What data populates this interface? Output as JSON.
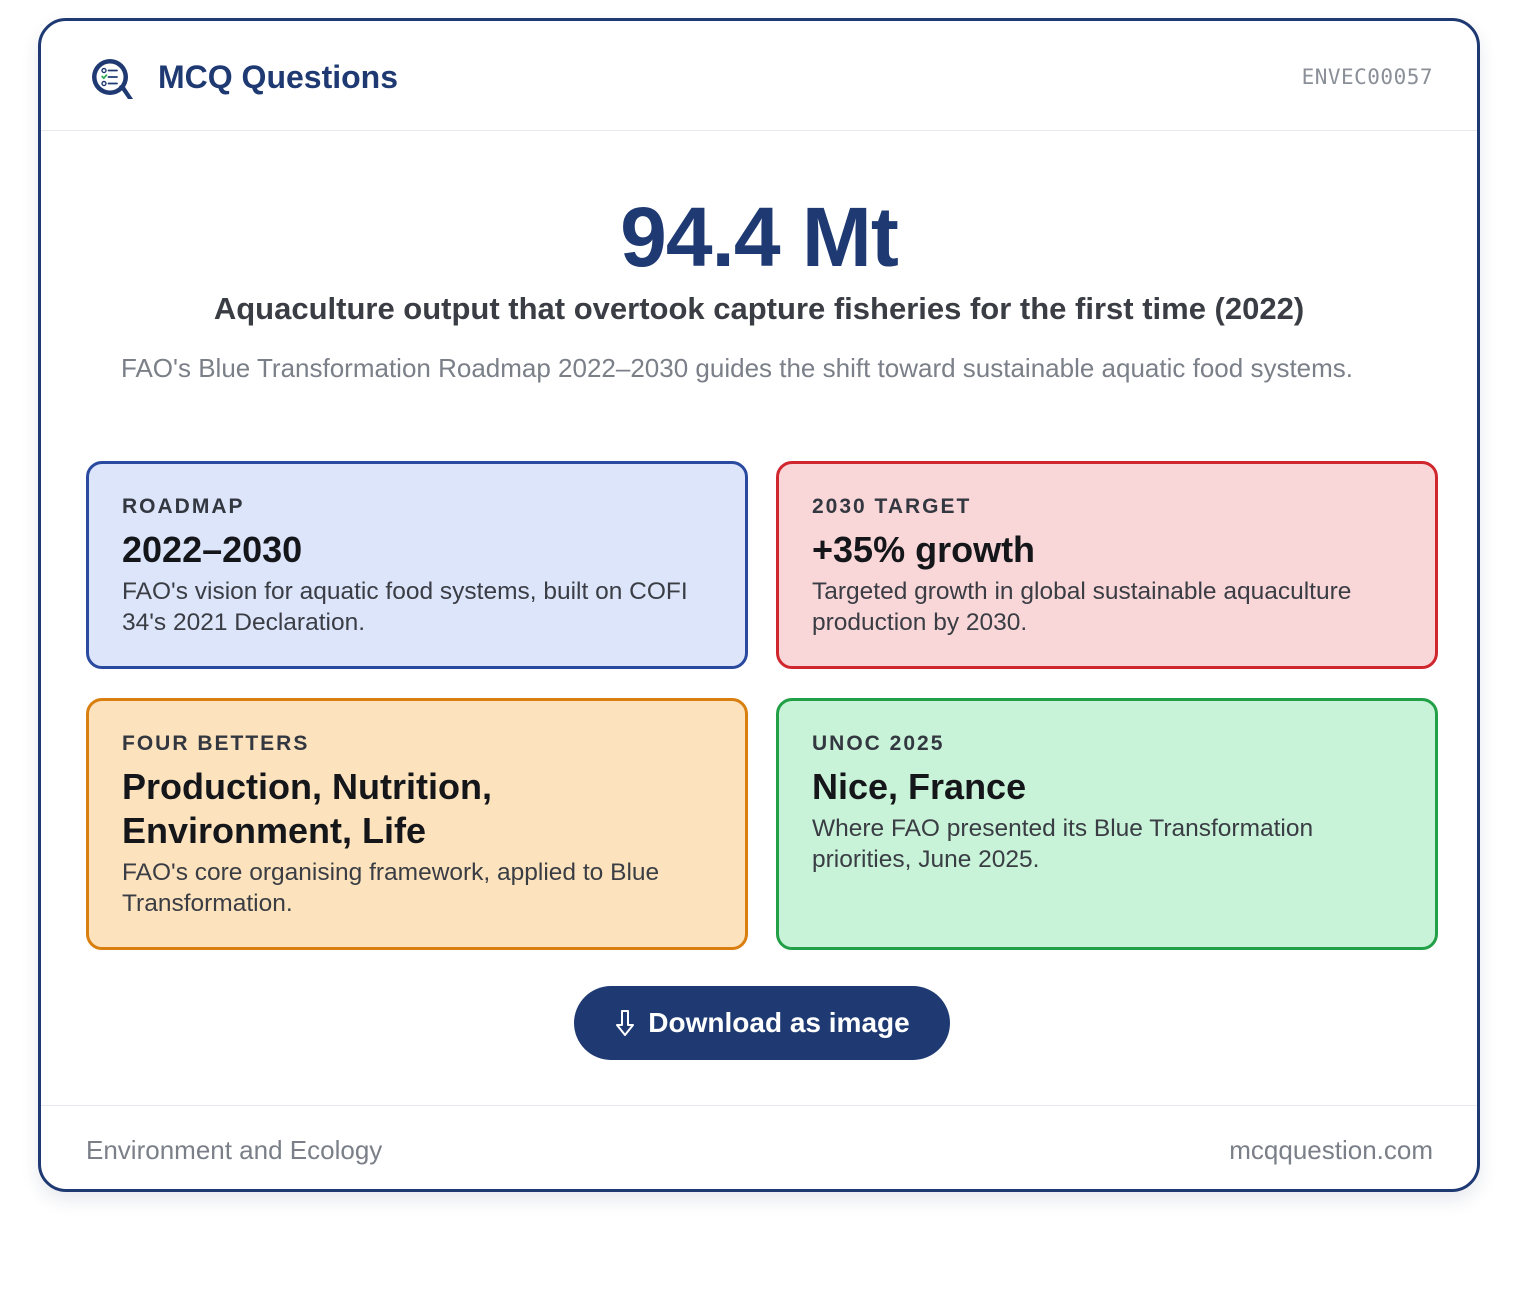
{
  "header": {
    "brand": "MCQ Questions",
    "code": "ENVEC00057"
  },
  "stat": {
    "value": "94.4 Mt",
    "caption": "Aquaculture output that overtook capture fisheries for the first time (2022)",
    "description": "FAO's Blue Transformation Roadmap 2022–2030 guides the shift toward sustainable aquatic food systems."
  },
  "boxes": [
    {
      "label": "ROADMAP",
      "value": "2022–2030",
      "text": "FAO's vision for aquatic food systems, built on COFI 34's 2021 Declaration.",
      "background": "#dde5fb",
      "border": "#2a4aa0"
    },
    {
      "label": "2030 TARGET",
      "value": "+35% growth",
      "text": "Targeted growth in global sustainable aquaculture production by 2030.",
      "background": "#f9d7d9",
      "border": "#d0262e"
    },
    {
      "label": "FOUR BETTERS",
      "value": "Production, Nutrition, Environment, Life",
      "text": "FAO's core organising framework, applied to Blue Transformation.",
      "background": "#fce3bd",
      "border": "#d97f0f"
    },
    {
      "label": "UNOC 2025",
      "value": "Nice, France",
      "text": "Where FAO presented its Blue Transformation priorities, June 2025.",
      "background": "#c8f3d8",
      "border": "#22a047"
    }
  ],
  "download": {
    "label": "Download as image",
    "icon": "download-arrow-icon"
  },
  "footer": {
    "category": "Environment and Ecology",
    "site": "mcqquestion.com"
  },
  "colors": {
    "brand": "#1f3a73",
    "muted": "#7a7f88"
  }
}
